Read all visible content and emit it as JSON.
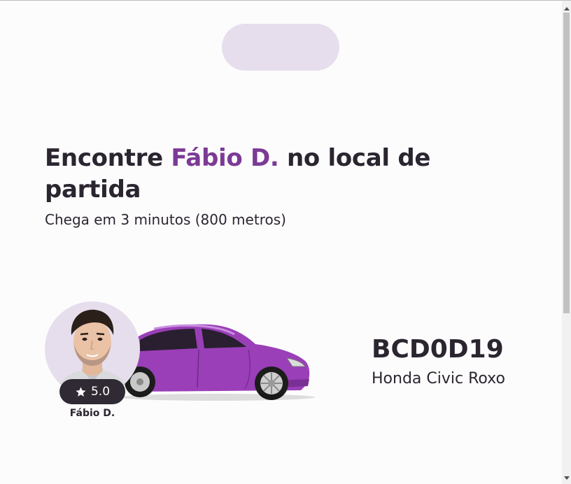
{
  "colors": {
    "accent": "#7c3a95",
    "handle": "#e6deec",
    "avatar_bg": "#e6deec",
    "rating_bg": "#2f2a33",
    "car_body": "#9a3fb8",
    "text": "#2b2530"
  },
  "headline": {
    "prefix": "Encontre ",
    "driver_name": "Fábio D.",
    "suffix": " no local de partida"
  },
  "subtitle": "Chega em 3 minutos (800 metros)",
  "driver": {
    "name": "Fábio D.",
    "rating": "5.0",
    "rating_icon": "star-icon"
  },
  "vehicle": {
    "plate": "BCD0D19",
    "model": "Honda Civic Roxo"
  }
}
